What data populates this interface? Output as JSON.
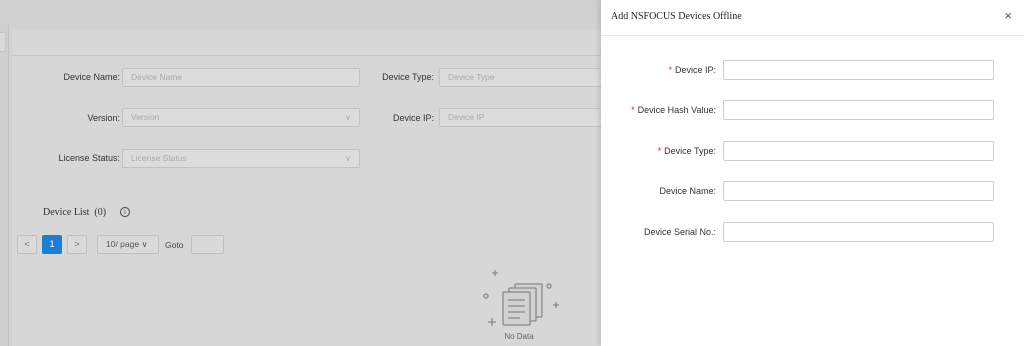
{
  "background": {
    "filters": [
      {
        "label": "Device Name",
        "placeholder": "Device Name"
      },
      {
        "label": "Device Type",
        "placeholder": "Device Type"
      },
      {
        "label": "Version",
        "placeholder": "Version"
      },
      {
        "label": "Device IP",
        "placeholder": "Device IP"
      },
      {
        "label": "License Status",
        "placeholder": "License Status"
      }
    ],
    "list_title": "Device List",
    "list_count": "(0)",
    "pagination": {
      "prev": "<",
      "current_page": "1",
      "next": ">",
      "page_size": "10/ page",
      "goto_label": "Goto"
    },
    "empty_text": "No Data"
  },
  "drawer": {
    "title": "Add NSFOCUS Devices Offline",
    "close": "×",
    "fields": [
      {
        "label": "Device IP",
        "required": true
      },
      {
        "label": "Device Hash Value",
        "required": true
      },
      {
        "label": "Device Type",
        "required": true
      },
      {
        "label": "Device Name",
        "required": false
      },
      {
        "label": "Device Serial No.",
        "required": false
      }
    ]
  },
  "colors": {
    "primary": "#1a7fd4",
    "required": "#e02020",
    "overlay": "#d2d2d2"
  }
}
